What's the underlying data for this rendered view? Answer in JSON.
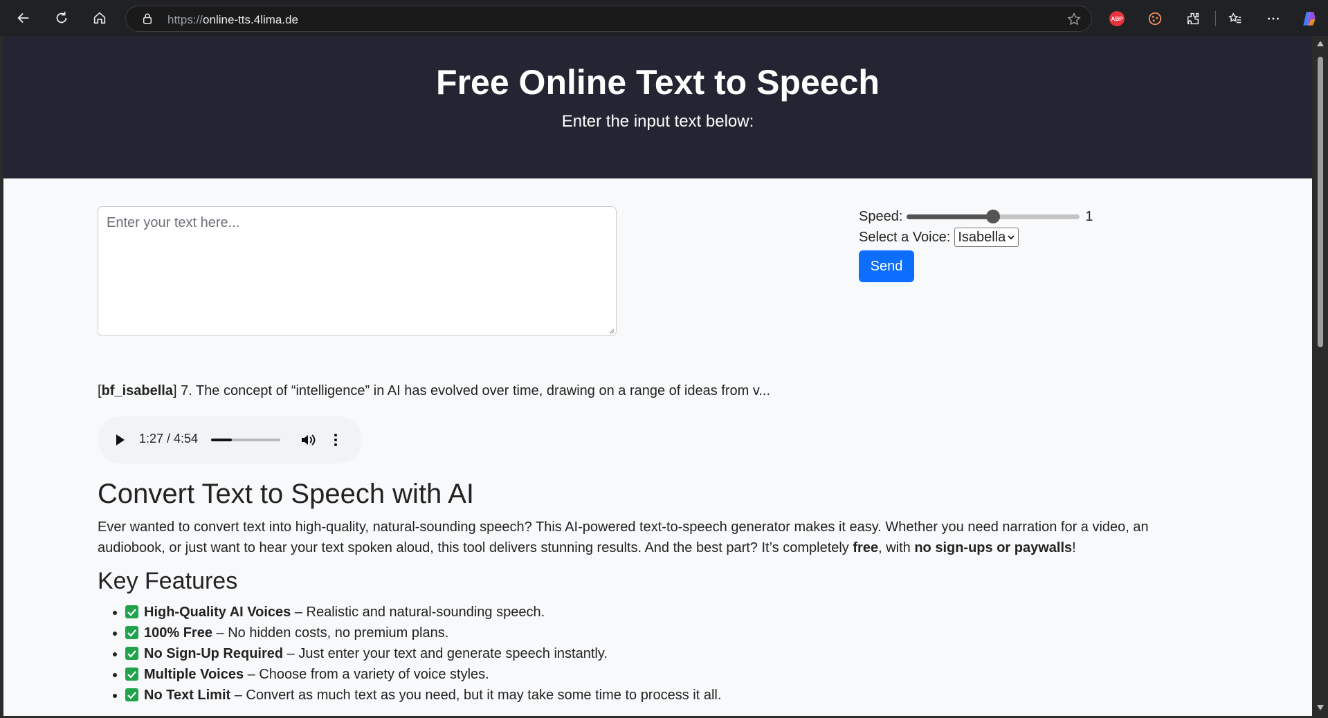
{
  "browser": {
    "url_scheme": "https://",
    "url_host": "online-tts.4lima.de",
    "abp_label": "ABP"
  },
  "hero": {
    "title": "Free Online Text to Speech",
    "subtitle": "Enter the input text below:"
  },
  "input": {
    "placeholder": "Enter your text here..."
  },
  "controls": {
    "speed_label": "Speed:",
    "speed_value": "1",
    "speed_level": 0.5,
    "voice_label": "Select a Voice:",
    "voice_selected": "Isabella",
    "send_label": "Send"
  },
  "result": {
    "voice_tag": "bf_isabella",
    "text": "7. The concept of “intelligence” in AI has evolved over time, drawing on a range of ideas from v..."
  },
  "audio": {
    "time": "1:27 / 4:54",
    "progress": 0.296
  },
  "content": {
    "heading": "Convert Text to Speech with AI",
    "intro_pre": "Ever wanted to convert text into high-quality, natural-sounding speech? This AI-powered text-to-speech generator makes it easy. Whether you need narration for a video, an audiobook, or just want to hear your text spoken aloud, this tool delivers stunning results. And the best part? It’s completely ",
    "intro_bold1": "free",
    "intro_mid": ", with ",
    "intro_bold2": "no sign-ups or paywalls",
    "intro_end": "!",
    "features_heading": "Key Features",
    "features": [
      {
        "title": "High-Quality AI Voices",
        "desc": " – Realistic and natural-sounding speech."
      },
      {
        "title": "100% Free",
        "desc": " – No hidden costs, no premium plans."
      },
      {
        "title": "No Sign-Up Required",
        "desc": " – Just enter your text and generate speech instantly."
      },
      {
        "title": "Multiple Voices",
        "desc": " – Choose from a variety of voice styles."
      },
      {
        "title": "No Text Limit",
        "desc": " – Convert as much text as you need, but it may take some time to process it all."
      }
    ]
  }
}
